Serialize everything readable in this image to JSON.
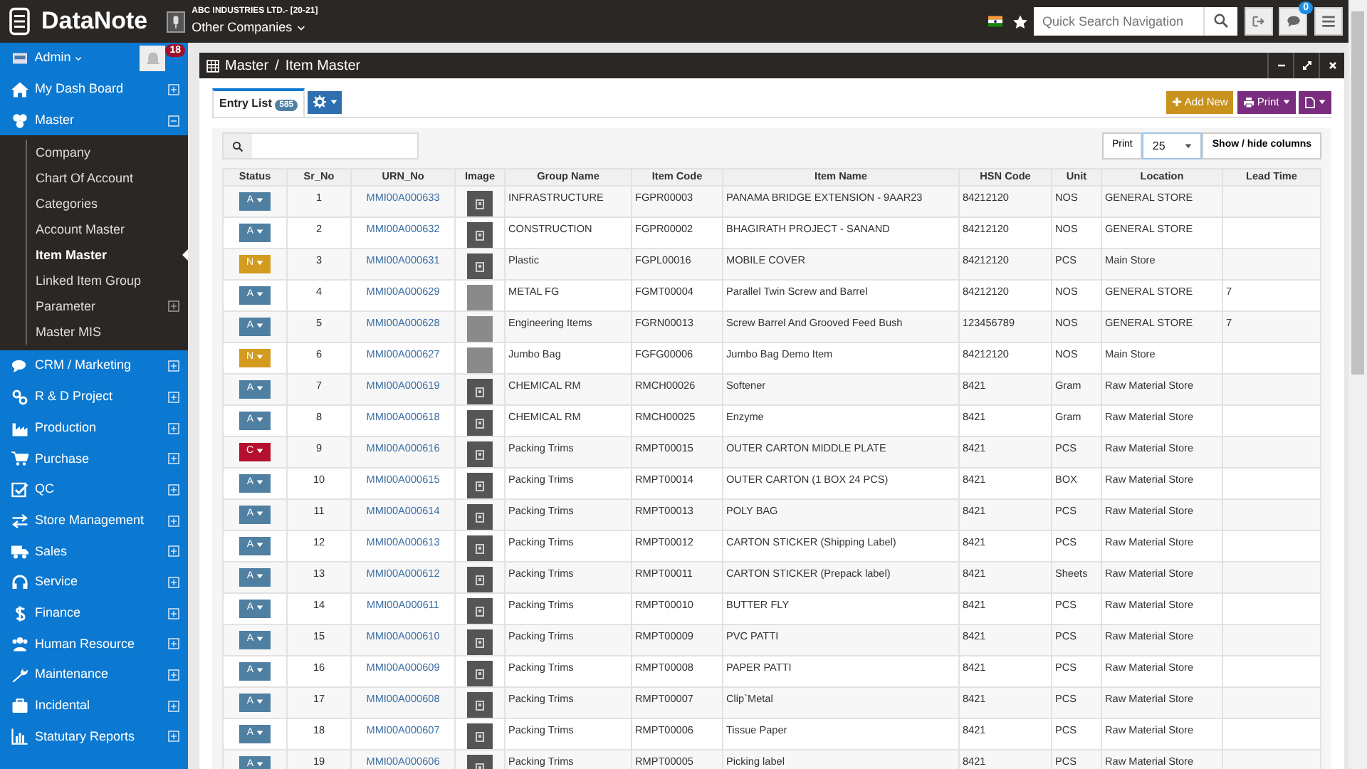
{
  "topbar": {
    "logo": "DataNote",
    "company": "ABC INDUSTRIES LTD.- [20-21]",
    "company_switch": "Other Companies",
    "company_switch_expanded": false,
    "search": {
      "placeholder": "Quick Search Navigation"
    },
    "chat_badge": "0"
  },
  "sidebar": {
    "user": "Admin",
    "notification_badge": "18",
    "menu": [
      {
        "label": "My Dash Board",
        "expanded": false
      },
      {
        "label": "Master",
        "expanded": true,
        "children": [
          {
            "label": "Company",
            "kind": "link",
            "selected": false
          },
          {
            "label": "Chart Of Account",
            "kind": "link",
            "selected": false
          },
          {
            "label": "Categories",
            "kind": "link",
            "selected": false
          },
          {
            "label": "Account Master",
            "kind": "link",
            "selected": false
          },
          {
            "label": "Item Master",
            "kind": "link",
            "selected": true
          },
          {
            "label": "Linked Item Group",
            "kind": "link",
            "selected": false
          },
          {
            "label": "Parameter",
            "kind": "group",
            "selected": false,
            "expanded": false
          },
          {
            "label": "Master MIS",
            "kind": "link",
            "selected": false
          }
        ]
      },
      {
        "label": "CRM / Marketing",
        "expanded": false
      },
      {
        "label": "R & D Project",
        "expanded": false
      },
      {
        "label": "Production",
        "expanded": false
      },
      {
        "label": "Purchase",
        "expanded": false
      },
      {
        "label": "QC",
        "expanded": false
      },
      {
        "label": "Store Management",
        "expanded": false
      },
      {
        "label": "Sales",
        "expanded": false
      },
      {
        "label": "Service",
        "expanded": false
      },
      {
        "label": "Finance",
        "expanded": false
      },
      {
        "label": "Human Resource",
        "expanded": false
      },
      {
        "label": "Maintenance",
        "expanded": false
      },
      {
        "label": "Incidental",
        "expanded": false
      },
      {
        "label": "Statutary Reports",
        "expanded": false
      }
    ]
  },
  "panel": {
    "breadcrumb": [
      "Master",
      "Item Master"
    ],
    "separator": "/",
    "tabs": [
      {
        "label": "Entry List",
        "badge": "585",
        "selected": true
      }
    ],
    "buttons": {
      "add_new": "Add New",
      "print": "Print"
    },
    "toolbar": {
      "print": "Print",
      "page_size": "25",
      "columns": "Show / hide columns"
    },
    "table": {
      "columns": [
        "Status",
        "Sr_No",
        "URN_No",
        "Image",
        "Group Name",
        "Item Code",
        "Item Name",
        "HSN Code",
        "Unit",
        "Location",
        "Lead Time"
      ],
      "rows": [
        {
          "status": "A",
          "color": "#4f7fa1",
          "sr_no": "1",
          "urn_no": "MMI00A000633",
          "kind": "placeholder",
          "group_name": "INFRASTRUCTURE",
          "item_code": "FGPR00003",
          "item_name": "PANAMA BRIDGE EXTENSION - 9AAR23",
          "hsn_code": "84212120",
          "unit": "NOS",
          "location": "GENERAL STORE"
        },
        {
          "status": "A",
          "color": "#4f7fa1",
          "sr_no": "2",
          "urn_no": "MMI00A000632",
          "kind": "placeholder",
          "group_name": "CONSTRUCTION",
          "item_code": "FGPR00002",
          "item_name": "BHAGIRATH PROJECT - SANAND",
          "hsn_code": "84212120",
          "unit": "NOS",
          "location": "GENERAL STORE"
        },
        {
          "status": "N",
          "color": "#d39b1f",
          "sr_no": "3",
          "urn_no": "MMI00A000631",
          "kind": "placeholder",
          "group_name": "Plastic",
          "item_code": "FGPL00016",
          "item_name": "MOBILE COVER",
          "hsn_code": "84212120",
          "unit": "PCS",
          "location": "Main Store"
        },
        {
          "status": "A",
          "color": "#4f7fa1",
          "sr_no": "4",
          "urn_no": "MMI00A000629",
          "kind": "photo",
          "group_name": "METAL FG",
          "item_code": "FGMT00004",
          "item_name": "Parallel Twin Screw and Barrel",
          "hsn_code": "84212120",
          "unit": "NOS",
          "location": "GENERAL STORE",
          "lead_time": "7"
        },
        {
          "status": "A",
          "color": "#4f7fa1",
          "sr_no": "5",
          "urn_no": "MMI00A000628",
          "kind": "photo",
          "group_name": "Engineering Items",
          "item_code": "FGRN00013",
          "item_name": "Screw Barrel And Grooved Feed Bush",
          "hsn_code": "123456789",
          "unit": "NOS",
          "location": "GENERAL STORE",
          "lead_time": "7"
        },
        {
          "status": "N",
          "color": "#d39b1f",
          "sr_no": "6",
          "urn_no": "MMI00A000627",
          "kind": "photo",
          "group_name": "Jumbo Bag",
          "item_code": "FGFG00006",
          "item_name": "Jumbo Bag Demo Item",
          "hsn_code": "84212120",
          "unit": "NOS",
          "location": "Main Store"
        },
        {
          "status": "A",
          "color": "#4f7fa1",
          "sr_no": "7",
          "urn_no": "MMI00A000619",
          "kind": "placeholder",
          "group_name": "CHEMICAL RM",
          "item_code": "RMCH00026",
          "item_name": "Softener",
          "hsn_code": "8421",
          "unit": "Gram",
          "location": "Raw Material Store"
        },
        {
          "status": "A",
          "color": "#4f7fa1",
          "sr_no": "8",
          "urn_no": "MMI00A000618",
          "kind": "placeholder",
          "group_name": "CHEMICAL RM",
          "item_code": "RMCH00025",
          "item_name": "Enzyme",
          "hsn_code": "8421",
          "unit": "Gram",
          "location": "Raw Material Store"
        },
        {
          "status": "C",
          "color": "#b5102d",
          "sr_no": "9",
          "urn_no": "MMI00A000616",
          "kind": "placeholder",
          "group_name": "Packing Trims",
          "item_code": "RMPT00015",
          "item_name": "OUTER CARTON MIDDLE PLATE",
          "hsn_code": "8421",
          "unit": "PCS",
          "location": "Raw Material Store"
        },
        {
          "status": "A",
          "color": "#4f7fa1",
          "sr_no": "10",
          "urn_no": "MMI00A000615",
          "kind": "placeholder",
          "group_name": "Packing Trims",
          "item_code": "RMPT00014",
          "item_name": "OUTER CARTON (1 BOX 24 PCS)",
          "hsn_code": "8421",
          "unit": "BOX",
          "location": "Raw Material Store"
        },
        {
          "status": "A",
          "color": "#4f7fa1",
          "sr_no": "11",
          "urn_no": "MMI00A000614",
          "kind": "placeholder",
          "group_name": "Packing Trims",
          "item_code": "RMPT00013",
          "item_name": "POLY BAG",
          "hsn_code": "8421",
          "unit": "PCS",
          "location": "Raw Material Store"
        },
        {
          "status": "A",
          "color": "#4f7fa1",
          "sr_no": "12",
          "urn_no": "MMI00A000613",
          "kind": "placeholder",
          "group_name": "Packing Trims",
          "item_code": "RMPT00012",
          "item_name": "CARTON STICKER (Shipping Label)",
          "hsn_code": "8421",
          "unit": "PCS",
          "location": "Raw Material Store"
        },
        {
          "status": "A",
          "color": "#4f7fa1",
          "sr_no": "13",
          "urn_no": "MMI00A000612",
          "kind": "placeholder",
          "group_name": "Packing Trims",
          "item_code": "RMPT00011",
          "item_name": "CARTON STICKER (Prepack label)",
          "hsn_code": "8421",
          "unit": "Sheets",
          "location": "Raw Material Store"
        },
        {
          "status": "A",
          "color": "#4f7fa1",
          "sr_no": "14",
          "urn_no": "MMI00A000611",
          "kind": "placeholder",
          "group_name": "Packing Trims",
          "item_code": "RMPT00010",
          "item_name": "BUTTER FLY",
          "hsn_code": "8421",
          "unit": "PCS",
          "location": "Raw Material Store"
        },
        {
          "status": "A",
          "color": "#4f7fa1",
          "sr_no": "15",
          "urn_no": "MMI00A000610",
          "kind": "placeholder",
          "group_name": "Packing Trims",
          "item_code": "RMPT00009",
          "item_name": "PVC PATTI",
          "hsn_code": "8421",
          "unit": "PCS",
          "location": "Raw Material Store"
        },
        {
          "status": "A",
          "color": "#4f7fa1",
          "sr_no": "16",
          "urn_no": "MMI00A000609",
          "kind": "placeholder",
          "group_name": "Packing Trims",
          "item_code": "RMPT00008",
          "item_name": "PAPER PATTI",
          "hsn_code": "8421",
          "unit": "PCS",
          "location": "Raw Material Store"
        },
        {
          "status": "A",
          "color": "#4f7fa1",
          "sr_no": "17",
          "urn_no": "MMI00A000608",
          "kind": "placeholder",
          "group_name": "Packing Trims",
          "item_code": "RMPT00007",
          "item_name": "Clip`Metal",
          "hsn_code": "8421",
          "unit": "PCS",
          "location": "Raw Material Store"
        },
        {
          "status": "A",
          "color": "#4f7fa1",
          "sr_no": "18",
          "urn_no": "MMI00A000607",
          "kind": "placeholder",
          "group_name": "Packing Trims",
          "item_code": "RMPT00006",
          "item_name": "Tissue Paper",
          "hsn_code": "8421",
          "unit": "PCS",
          "location": "Raw Material Store"
        },
        {
          "status": "A",
          "color": "#4f7fa1",
          "sr_no": "19",
          "urn_no": "MMI00A000606",
          "kind": "placeholder",
          "group_name": "Packing Trims",
          "item_code": "RMPT00005",
          "item_name": "Picking label",
          "hsn_code": "8421",
          "unit": "PCS",
          "location": "Raw Material Store"
        }
      ]
    }
  }
}
